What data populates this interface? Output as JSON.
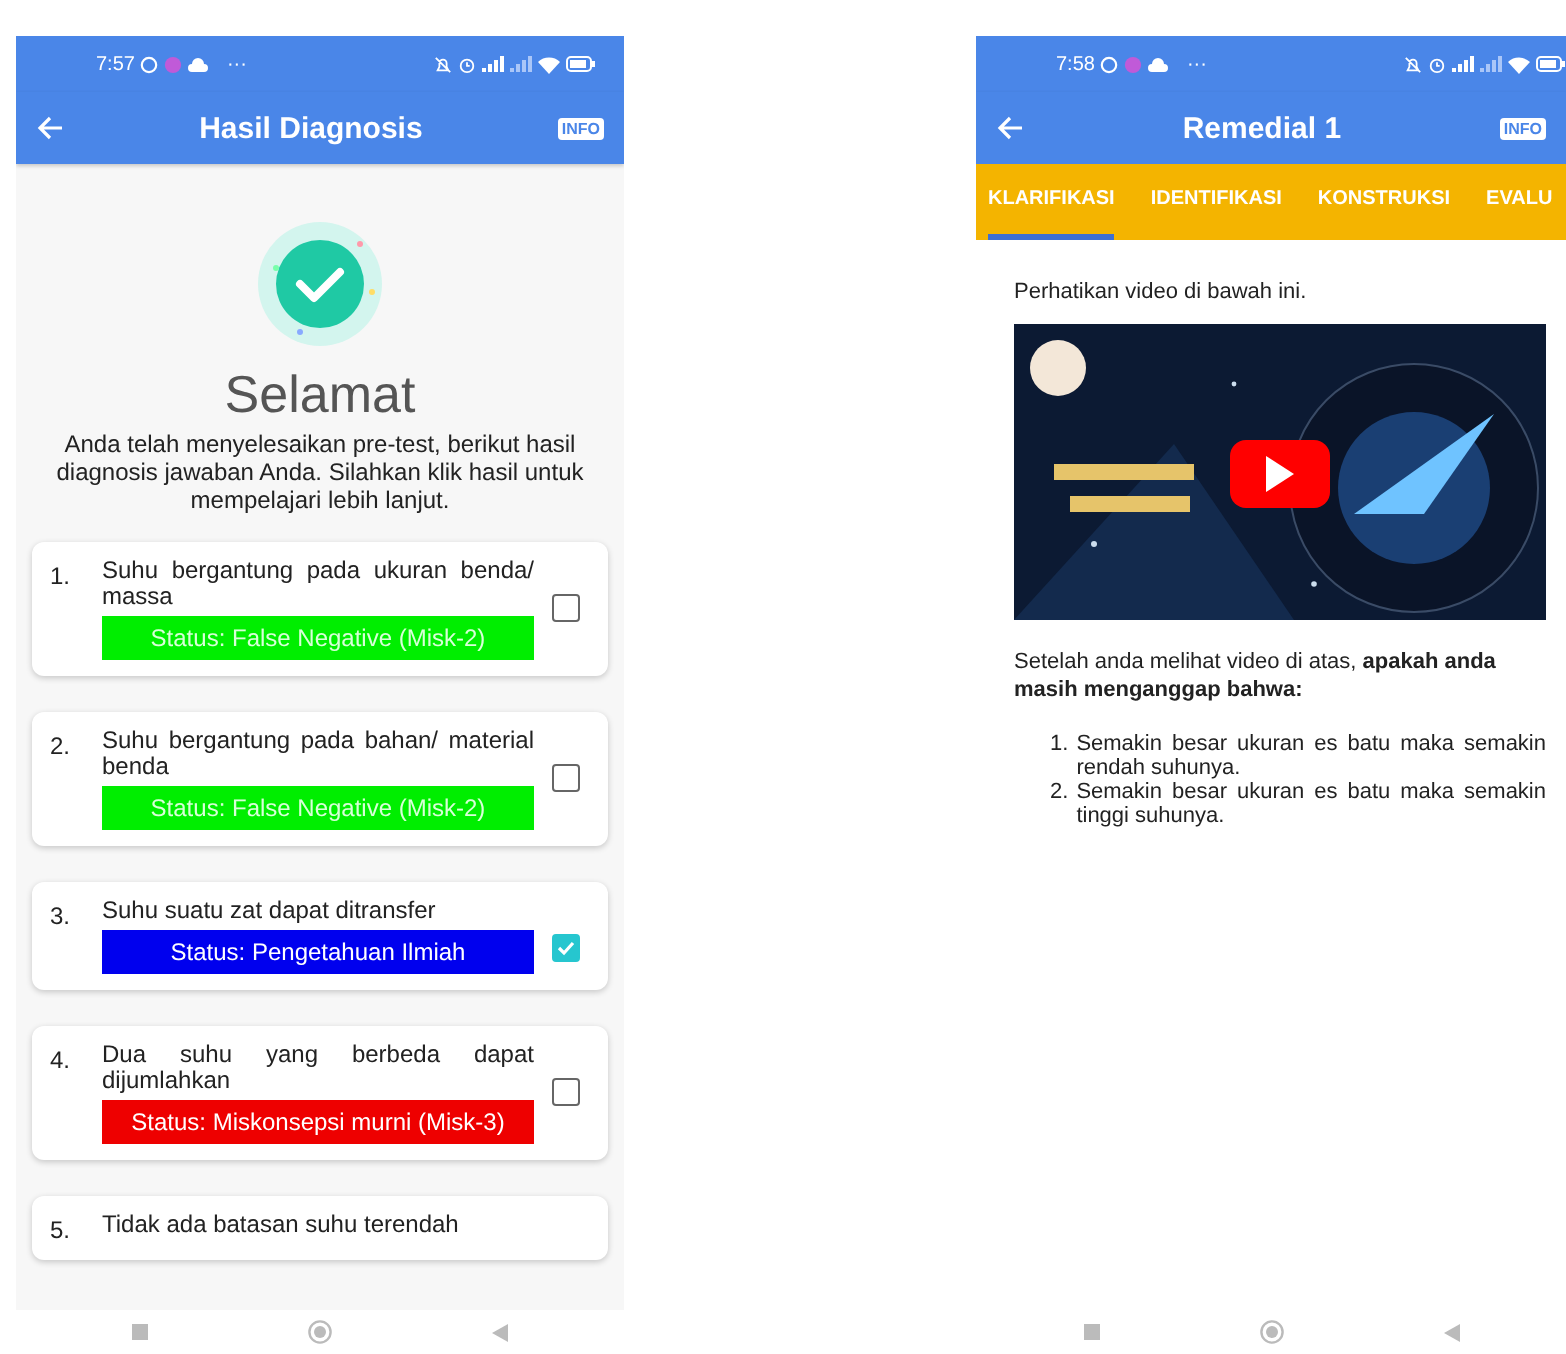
{
  "left_screen": {
    "status_bar": {
      "time": "7:57",
      "more": "···"
    },
    "header": {
      "title": "Hasil Diagnosis",
      "badge": "INFO"
    },
    "heading": "Selamat",
    "intro": "Anda telah menyelesaikan pre-test, berikut hasil diagnosis jawaban Anda. Silahkan klik hasil untuk mempelajari lebih lanjut.",
    "results": [
      {
        "number": "1.",
        "text": "Suhu bergantung pada ukuran benda/ massa",
        "status": "Status: False Negative (Misk-2)",
        "color": "#00ee00",
        "checked": false
      },
      {
        "number": "2.",
        "text": "Suhu bergantung pada bahan/ material benda",
        "status": "Status: False Negative (Misk-2)",
        "color": "#00ee00",
        "checked": false
      },
      {
        "number": "3.",
        "text": "Suhu suatu zat dapat ditransfer",
        "status": "Status: Pengetahuan Ilmiah",
        "color": "#0000ee",
        "checked": true
      },
      {
        "number": "4.",
        "text": "Dua suhu yang berbeda dapat dijumlahkan",
        "status": "Status: Miskonsepsi murni (Misk-3)",
        "color": "#ee0000",
        "checked": false
      },
      {
        "number": "5.",
        "text": "Tidak ada batasan suhu terendah"
      }
    ]
  },
  "right_screen": {
    "status_bar": {
      "time": "7:58",
      "more": "···"
    },
    "header": {
      "title": "Remedial 1",
      "badge": "INFO"
    },
    "tabs": [
      {
        "label": "KLARIFIKASI",
        "selected": true
      },
      {
        "label": "IDENTIFIKASI",
        "selected": false
      },
      {
        "label": "KONSTRUKSI",
        "selected": false
      },
      {
        "label": "EVALU",
        "selected": false
      }
    ],
    "instruction": "Perhatikan video di bawah ini.",
    "question": "Setelah anda melihat video di atas, **apakah anda masih menganggap bahwa:**",
    "statements": [
      {
        "number": "1.",
        "text": "Semakin besar ukuran es batu maka semakin rendah suhunya."
      },
      {
        "number": "2.",
        "text": "Semakin besar ukuran es batu maka semakin tinggi suhunya."
      }
    ]
  }
}
